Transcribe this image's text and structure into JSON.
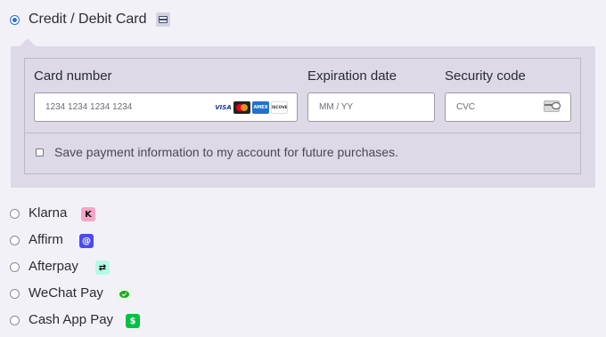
{
  "methods": {
    "card": {
      "label": "Credit / Debit Card",
      "selected": true,
      "icon": "credit-card-icon"
    },
    "klarna": {
      "label": "Klarna",
      "logo_text": "K",
      "icon": "klarna-logo"
    },
    "affirm": {
      "label": "Affirm",
      "logo_text": "@",
      "icon": "affirm-logo"
    },
    "afterpay": {
      "label": "Afterpay",
      "logo_text": "⇄",
      "icon": "afterpay-logo"
    },
    "wechat": {
      "label": "WeChat Pay",
      "icon": "wechat-logo"
    },
    "cashapp": {
      "label": "Cash App Pay",
      "logo_text": "$",
      "icon": "cash-app-logo"
    }
  },
  "card_form": {
    "card_number_label": "Card number",
    "card_number_placeholder": "1234 1234 1234 1234",
    "expiration_label": "Expiration date",
    "expiration_placeholder": "MM / YY",
    "security_label": "Security code",
    "security_placeholder": "CVC",
    "brands": {
      "visa": "VISA",
      "mastercard": "mastercard-logo",
      "amex": "AMEX",
      "discover": "DISCOVER"
    },
    "save_label": "Save payment information to my account for future purchases."
  },
  "colors": {
    "accent": "#2c6fd6",
    "panel_bg": "#ddd9e6",
    "page_bg": "#f3f1f8"
  }
}
